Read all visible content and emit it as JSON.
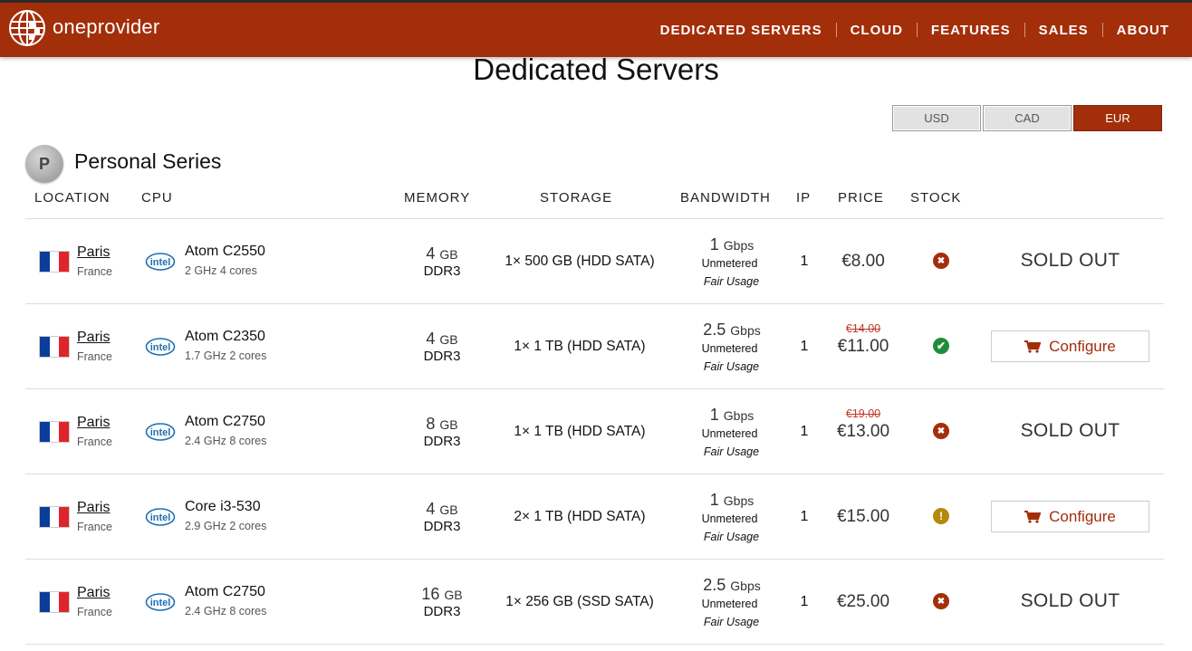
{
  "brand": {
    "name": "oneprovider",
    "accent": "#a32e0a"
  },
  "nav": [
    "DEDICATED SERVERS",
    "CLOUD",
    "FEATURES",
    "SALES",
    "ABOUT"
  ],
  "page_title": "Dedicated Servers",
  "currency": {
    "options": [
      "USD",
      "CAD",
      "EUR"
    ],
    "selected": "EUR"
  },
  "series": {
    "badge": "P",
    "title": "Personal Series"
  },
  "columns": {
    "location": "LOCATION",
    "cpu": "CPU",
    "memory": "MEMORY",
    "storage": "STORAGE",
    "bandwidth": "BANDWIDTH",
    "ip": "IP",
    "price": "PRICE",
    "stock": "STOCK"
  },
  "labels": {
    "configure": "Configure",
    "sold_out": "SOLD OUT"
  },
  "rows": [
    {
      "city": "Paris",
      "country": "France",
      "cpu_name": "Atom C2550",
      "cpu_detail": "2 GHz 4 cores",
      "mem_size": "4",
      "mem_unit": "GB",
      "mem_type": "DDR3",
      "storage": "1× 500 GB (HDD SATA)",
      "bw_speed": "1",
      "bw_unit": "Gbps",
      "bw_type": "Unmetered",
      "bw_policy": "Fair Usage",
      "ip": "1",
      "old_price": "",
      "price": "€8.00",
      "stock": "sold-out",
      "action": "SOLD OUT"
    },
    {
      "city": "Paris",
      "country": "France",
      "cpu_name": "Atom C2350",
      "cpu_detail": "1.7 GHz 2 cores",
      "mem_size": "4",
      "mem_unit": "GB",
      "mem_type": "DDR3",
      "storage": "1× 1 TB (HDD SATA)",
      "bw_speed": "2.5",
      "bw_unit": "Gbps",
      "bw_type": "Unmetered",
      "bw_policy": "Fair Usage",
      "ip": "1",
      "old_price": "€14.00",
      "price": "€11.00",
      "stock": "in-stock",
      "action": "Configure"
    },
    {
      "city": "Paris",
      "country": "France",
      "cpu_name": "Atom C2750",
      "cpu_detail": "2.4 GHz 8 cores",
      "mem_size": "8",
      "mem_unit": "GB",
      "mem_type": "DDR3",
      "storage": "1× 1 TB (HDD SATA)",
      "bw_speed": "1",
      "bw_unit": "Gbps",
      "bw_type": "Unmetered",
      "bw_policy": "Fair Usage",
      "ip": "1",
      "old_price": "€19.00",
      "price": "€13.00",
      "stock": "sold-out",
      "action": "SOLD OUT"
    },
    {
      "city": "Paris",
      "country": "France",
      "cpu_name": "Core i3-530",
      "cpu_detail": "2.9 GHz 2 cores",
      "mem_size": "4",
      "mem_unit": "GB",
      "mem_type": "DDR3",
      "storage": "2× 1 TB (HDD SATA)",
      "bw_speed": "1",
      "bw_unit": "Gbps",
      "bw_type": "Unmetered",
      "bw_policy": "Fair Usage",
      "ip": "1",
      "old_price": "",
      "price": "€15.00",
      "stock": "limited",
      "action": "Configure"
    },
    {
      "city": "Paris",
      "country": "France",
      "cpu_name": "Atom C2750",
      "cpu_detail": "2.4 GHz 8 cores",
      "mem_size": "16",
      "mem_unit": "GB",
      "mem_type": "DDR3",
      "storage": "1× 256 GB (SSD SATA)",
      "bw_speed": "2.5",
      "bw_unit": "Gbps",
      "bw_type": "Unmetered",
      "bw_policy": "Fair Usage",
      "ip": "1",
      "old_price": "",
      "price": "€25.00",
      "stock": "sold-out",
      "action": "SOLD OUT"
    }
  ]
}
